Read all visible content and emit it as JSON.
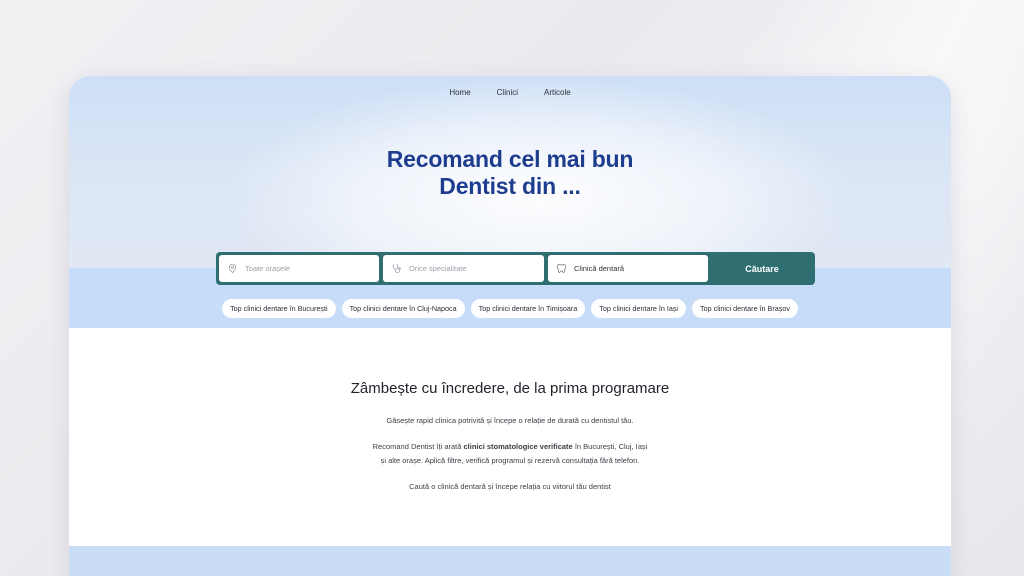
{
  "nav": {
    "items": [
      {
        "label": "Home"
      },
      {
        "label": "Clinici"
      },
      {
        "label": "Articole"
      }
    ]
  },
  "hero": {
    "title_line1": "Recomand cel mai bun",
    "title_line2": "Dentist din ..."
  },
  "search": {
    "city_placeholder": "Toate orașele",
    "specialty_placeholder": "Orice specialitate",
    "type_value": "Clinică dentară",
    "button_label": "Căutare",
    "icons": [
      "location-pin-icon",
      "stethoscope-icon",
      "tooth-icon"
    ]
  },
  "chips": [
    {
      "label": "Top clinici dentare în București"
    },
    {
      "label": "Top clinici dentare în Cluj-Napoca"
    },
    {
      "label": "Top clinici dentare în Timișoara"
    },
    {
      "label": "Top clinici dentare în Iași"
    },
    {
      "label": "Top clinici dentare în Brașov"
    }
  ],
  "intro": {
    "heading": "Zâmbește cu încredere, de la prima programare",
    "p1": "Găsește rapid clinica potrivită și începe o relație de durată cu dentistul tău.",
    "p2_before": "Recomand Dentist îți arată ",
    "p2_bold": "clinici stomatologice verificate",
    "p2_after": " în București, Cluj, Iași",
    "p2_line2": "și alte orașe. Aplică filtre, verifică programul și rezervă consultația fără telefon.",
    "p3": "Caută o clinică dentară și începe relația cu viitorul tău dentist"
  },
  "colors": {
    "title": "#1e3d8f",
    "search_bar": "#2f6f72",
    "hero_band": "#c6dcf8",
    "footer_band": "#c9ddf7"
  }
}
